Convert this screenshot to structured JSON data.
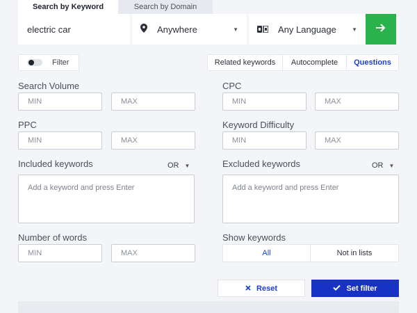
{
  "tabs": [
    {
      "label": "Search by Keyword",
      "active": true
    },
    {
      "label": "Search by Domain",
      "active": false
    }
  ],
  "search": {
    "keyword_value": "electric car",
    "location_value": "Anywhere",
    "language_value": "Any Language",
    "go_color": "#2bb24c"
  },
  "filter_toggle": {
    "label": "Filter"
  },
  "mode_tabs": [
    "Related keywords",
    "Autocomplete",
    "Questions"
  ],
  "mode_selected": "Questions",
  "fields": {
    "search_volume": {
      "label": "Search Volume",
      "min": "MIN",
      "max": "MAX"
    },
    "cpc": {
      "label": "CPC",
      "min": "MIN",
      "max": "MAX"
    },
    "ppc": {
      "label": "PPC",
      "min": "MIN",
      "max": "MAX"
    },
    "kd": {
      "label": "Keyword Difficulty",
      "min": "MIN",
      "max": "MAX"
    },
    "included": {
      "label": "Included keywords",
      "op": "OR",
      "placeholder": "Add a keyword and press Enter"
    },
    "excluded": {
      "label": "Excluded keywords",
      "op": "OR",
      "placeholder": "Add a keyword and press Enter"
    },
    "num_words": {
      "label": "Number of words",
      "min": "MIN",
      "max": "MAX"
    },
    "show_keywords": {
      "label": "Show keywords",
      "options": [
        "All",
        "Not in lists"
      ],
      "selected": "All"
    }
  },
  "actions": {
    "reset": "Reset",
    "set_filter": "Set filter"
  },
  "colors": {
    "accent_blue": "#1732c4",
    "green": "#2bb24c"
  }
}
